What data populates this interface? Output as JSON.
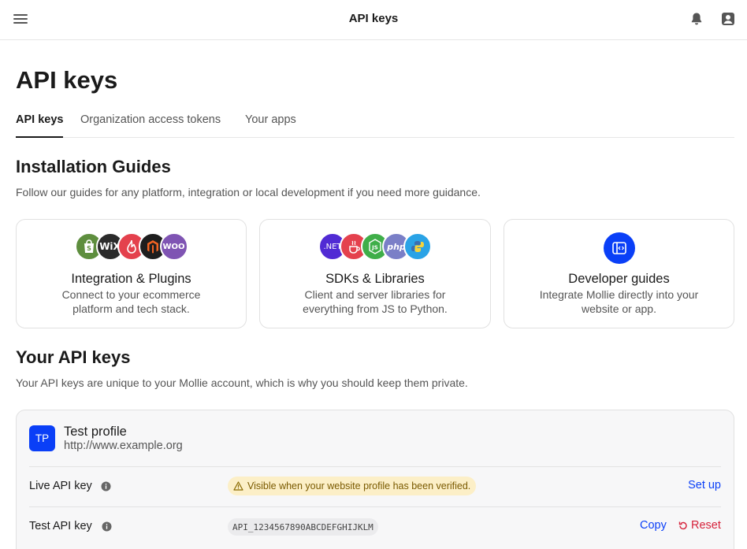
{
  "topbar": {
    "title": "API keys",
    "menu_icon": "menu-icon",
    "notification_icon": "bell-icon",
    "account_icon": "account-icon"
  },
  "page": {
    "title": "API keys",
    "tabs": [
      {
        "label": "API keys",
        "active": true
      },
      {
        "label": "Organization access tokens",
        "active": false
      },
      {
        "label": "Your apps",
        "active": false
      }
    ]
  },
  "installation": {
    "title": "Installation Guides",
    "description": "Follow our guides for any platform, integration or local development if you need more guidance.",
    "cards": [
      {
        "title": "Integration & Plugins",
        "description": "Connect to your ecommerce platform and tech stack.",
        "icons": [
          {
            "name": "shopify-icon",
            "glyph": "S",
            "color": "#5e8e3e"
          },
          {
            "name": "wix-icon",
            "glyph": "WiX",
            "color": "#2b2b2b"
          },
          {
            "name": "lightspeed-icon",
            "glyph": "",
            "color": "#e4414d"
          },
          {
            "name": "magento-icon",
            "glyph": "",
            "color": "#1e1e1e"
          },
          {
            "name": "woocommerce-icon",
            "glyph": "WOO",
            "color": "#7f54b3"
          }
        ]
      },
      {
        "title": "SDKs & Libraries",
        "description": "Client and server libraries for everything from JS to Python.",
        "icons": [
          {
            "name": "dotnet-icon",
            "glyph": ".NET",
            "color": "#512bd4"
          },
          {
            "name": "java-icon",
            "glyph": "",
            "color": "#e4414d"
          },
          {
            "name": "nodejs-icon",
            "glyph": "JS",
            "color": "#3fae49"
          },
          {
            "name": "php-icon",
            "glyph": "php",
            "color": "#7a7fc7"
          },
          {
            "name": "python-icon",
            "glyph": "",
            "color": "#2aa3e6"
          }
        ]
      },
      {
        "title": "Developer guides",
        "description": "Integrate Mollie directly into your website or app.",
        "icons": [
          {
            "name": "developer-code-icon",
            "glyph": "",
            "color": "#0a3ff7"
          }
        ]
      }
    ]
  },
  "api_keys": {
    "title": "Your API keys",
    "description": "Your API keys are unique to your Mollie account, which is why you should keep them private.",
    "profile": {
      "initials": "TP",
      "name": "Test profile",
      "url": "http://www.example.org"
    },
    "rows": [
      {
        "label": "Live API key",
        "status": "Visible when your website profile has been verified.",
        "action": "Set up"
      },
      {
        "label": "Test API key",
        "value": "API_1234567890ABCDEFGHIJKLM",
        "copy": "Copy",
        "reset": "Reset"
      }
    ]
  },
  "colors": {
    "accent": "#0a3ff7",
    "danger": "#d6223b",
    "warning_bg": "#fcefc7"
  }
}
